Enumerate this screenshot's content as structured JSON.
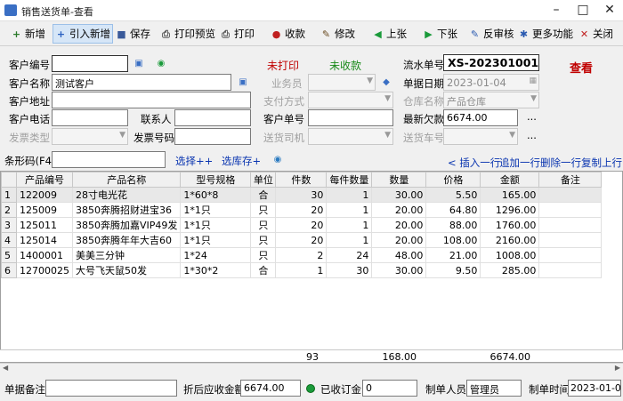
{
  "window": {
    "title": "销售送货单-查看"
  },
  "toolbar": [
    {
      "id": "new",
      "label": "新增",
      "icon": "+",
      "color": "#2a7a2a"
    },
    {
      "id": "import",
      "label": "引入新增",
      "icon": "+",
      "color": "#2a60c0"
    },
    {
      "id": "save",
      "label": "保存",
      "icon": "■",
      "color": "#3a5a9a"
    },
    {
      "id": "preview",
      "label": "打印预览",
      "icon": "⎙",
      "color": "#555"
    },
    {
      "id": "print",
      "label": "打印",
      "icon": "⎙",
      "color": "#555"
    },
    {
      "id": "collect",
      "label": "收款",
      "icon": "●",
      "color": "#c02020"
    },
    {
      "id": "modify",
      "label": "修改",
      "icon": "✎",
      "color": "#6a4a20"
    },
    {
      "id": "prev",
      "label": "上张",
      "icon": "◀",
      "color": "#1a9a3a"
    },
    {
      "id": "next",
      "label": "下张",
      "icon": "▶",
      "color": "#1a9a3a"
    },
    {
      "id": "unaudit",
      "label": "反审核",
      "icon": "✎",
      "color": "#2a5ab0"
    },
    {
      "id": "more",
      "label": "更多功能",
      "icon": "✱",
      "color": "#2a5ab0"
    },
    {
      "id": "close",
      "label": "关闭",
      "icon": "✕",
      "color": "#c02020"
    }
  ],
  "form": {
    "customer_no_label": "客户编号",
    "customer_no": "",
    "customer_name_label": "客户名称",
    "customer_name": "测试客户",
    "customer_addr_label": "客户地址",
    "customer_addr": "",
    "customer_phone_label": "客户电话",
    "customer_phone": "",
    "contact_label": "联系人",
    "contact": "",
    "invoice_type_label": "发票类型",
    "invoice_type": "",
    "invoice_no_label": "发票号码",
    "invoice_no": "",
    "status_print": "未打印",
    "status_collect": "未收款",
    "salesman_label": "业务员",
    "salesman": "",
    "pay_method_label": "支付方式",
    "pay_method": "",
    "customer_order_label": "客户单号",
    "customer_order": "",
    "driver_label": "送货司机",
    "driver": "",
    "serial_label": "流水单号",
    "serial": "XS-202301001",
    "date_label": "单据日期",
    "date": "2023-01-04",
    "warehouse_label": "仓库名称",
    "warehouse": "产品仓库",
    "debt_label": "最新欠款",
    "debt": "6674.00",
    "vehicle_label": "送货车号",
    "vehicle": "",
    "view_mode": "查看",
    "dots": "..."
  },
  "barcode": {
    "label": "条形码(F4)",
    "value": "",
    "select_pp": "选择++",
    "select_stock": "选库存+"
  },
  "row_actions": {
    "insert": "< 插入一行",
    "append": "追加一行",
    "delete": "删除一行",
    "copy": "复制上行"
  },
  "table": {
    "columns": [
      "产品编号",
      "产品名称",
      "型号规格",
      "单位",
      "件数",
      "每件数量",
      "数量",
      "价格",
      "金额",
      "备注"
    ],
    "rows": [
      {
        "n": "1",
        "code": "122009",
        "name": "28寸电光花",
        "spec": "1*60*8",
        "unit": "合",
        "pieces": "30",
        "per": "1",
        "qty": "30.00",
        "price": "5.50",
        "amount": "165.00",
        "note": ""
      },
      {
        "n": "2",
        "code": "125009",
        "name": "3850奔腾招财进宝36",
        "spec": "1*1只",
        "unit": "只",
        "pieces": "20",
        "per": "1",
        "qty": "20.00",
        "price": "64.80",
        "amount": "1296.00",
        "note": ""
      },
      {
        "n": "3",
        "code": "125011",
        "name": "3850奔腾加嘉VIP49发",
        "spec": "1*1只",
        "unit": "只",
        "pieces": "20",
        "per": "1",
        "qty": "20.00",
        "price": "88.00",
        "amount": "1760.00",
        "note": ""
      },
      {
        "n": "4",
        "code": "125014",
        "name": "3850奔腾年年大吉60",
        "spec": "1*1只",
        "unit": "只",
        "pieces": "20",
        "per": "1",
        "qty": "20.00",
        "price": "108.00",
        "amount": "2160.00",
        "note": ""
      },
      {
        "n": "5",
        "code": "1400001",
        "name": "美美三分钟",
        "spec": "1*24",
        "unit": "只",
        "pieces": "2",
        "per": "24",
        "qty": "48.00",
        "price": "21.00",
        "amount": "1008.00",
        "note": ""
      },
      {
        "n": "6",
        "code": "12700025",
        "name": "大号飞天鼠50发",
        "spec": "1*30*2",
        "unit": "合",
        "pieces": "1",
        "per": "30",
        "qty": "30.00",
        "price": "9.50",
        "amount": "285.00",
        "note": ""
      }
    ],
    "totals": {
      "pieces": "93",
      "qty": "168.00",
      "amount": "6674.00"
    }
  },
  "status": {
    "remark_label": "单据备注",
    "remark": "",
    "receivable_label": "折后应收金额",
    "receivable": "6674.00",
    "received_label": "已收订金",
    "received": "0",
    "maker_label": "制单人员",
    "maker": "管理员",
    "make_time_label": "制单时间",
    "make_time": "2023-01-04"
  },
  "colors": {
    "red": "#c00000",
    "green": "#1a8a1a",
    "link": "#0a35b0"
  }
}
